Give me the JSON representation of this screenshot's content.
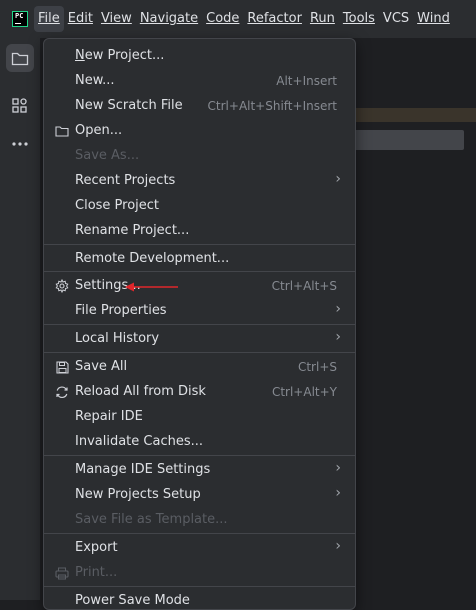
{
  "menubar": {
    "logo_text": "PC",
    "items": [
      {
        "label": "File",
        "active": true
      },
      {
        "label": "Edit"
      },
      {
        "label": "View"
      },
      {
        "label": "Navigate"
      },
      {
        "label": "Code"
      },
      {
        "label": "Refactor"
      },
      {
        "label": "Run"
      },
      {
        "label": "Tools"
      },
      {
        "label": "VCS"
      },
      {
        "label": "Wind"
      }
    ]
  },
  "toolstrip": {
    "icons": [
      "project-folder-icon",
      "structure-icon",
      "more-icon"
    ]
  },
  "file_menu": {
    "items": [
      {
        "label": "New Project...",
        "shortcut": "",
        "submenu": false,
        "disabled": false,
        "icon": ""
      },
      {
        "label": "New...",
        "shortcut": "Alt+Insert",
        "submenu": false,
        "disabled": false,
        "icon": ""
      },
      {
        "label": "New Scratch File",
        "shortcut": "Ctrl+Alt+Shift+Insert",
        "submenu": false,
        "disabled": false,
        "icon": ""
      },
      {
        "label": "Open...",
        "shortcut": "",
        "submenu": false,
        "disabled": false,
        "icon": "folder-icon"
      },
      {
        "label": "Save As...",
        "shortcut": "",
        "submenu": false,
        "disabled": true,
        "icon": ""
      },
      {
        "label": "Recent Projects",
        "shortcut": "",
        "submenu": true,
        "disabled": false,
        "icon": ""
      },
      {
        "label": "Close Project",
        "shortcut": "",
        "submenu": false,
        "disabled": false,
        "icon": ""
      },
      {
        "label": "Rename Project...",
        "shortcut": "",
        "submenu": false,
        "disabled": false,
        "icon": ""
      },
      {
        "label": "Remote Development...",
        "shortcut": "",
        "submenu": false,
        "disabled": false,
        "icon": ""
      },
      {
        "label": "Settings...",
        "shortcut": "Ctrl+Alt+S",
        "submenu": false,
        "disabled": false,
        "icon": "gear-icon"
      },
      {
        "label": "File Properties",
        "shortcut": "",
        "submenu": true,
        "disabled": false,
        "icon": ""
      },
      {
        "label": "Local History",
        "shortcut": "",
        "submenu": true,
        "disabled": false,
        "icon": ""
      },
      {
        "label": "Save All",
        "shortcut": "Ctrl+S",
        "submenu": false,
        "disabled": false,
        "icon": "save-icon"
      },
      {
        "label": "Reload All from Disk",
        "shortcut": "Ctrl+Alt+Y",
        "submenu": false,
        "disabled": false,
        "icon": "reload-icon"
      },
      {
        "label": "Repair IDE",
        "shortcut": "",
        "submenu": false,
        "disabled": false,
        "icon": ""
      },
      {
        "label": "Invalidate Caches...",
        "shortcut": "",
        "submenu": false,
        "disabled": false,
        "icon": ""
      },
      {
        "label": "Manage IDE Settings",
        "shortcut": "",
        "submenu": true,
        "disabled": false,
        "icon": ""
      },
      {
        "label": "New Projects Setup",
        "shortcut": "",
        "submenu": true,
        "disabled": false,
        "icon": ""
      },
      {
        "label": "Save File as Template...",
        "shortcut": "",
        "submenu": false,
        "disabled": true,
        "icon": ""
      },
      {
        "label": "Export",
        "shortcut": "",
        "submenu": true,
        "disabled": false,
        "icon": ""
      },
      {
        "label": "Print...",
        "shortcut": "",
        "submenu": false,
        "disabled": true,
        "icon": "print-icon"
      },
      {
        "label": "Power Save Mode",
        "shortcut": "",
        "submenu": false,
        "disabled": false,
        "icon": ""
      }
    ]
  },
  "annotation": {
    "color": "#e0262b",
    "target": "Settings..."
  },
  "colors": {
    "menu_bg": "#2b2d30",
    "accent_logo": "#21d789",
    "text": "#dfe1e5",
    "shortcut": "#868a91",
    "disabled": "#5a5d63"
  }
}
